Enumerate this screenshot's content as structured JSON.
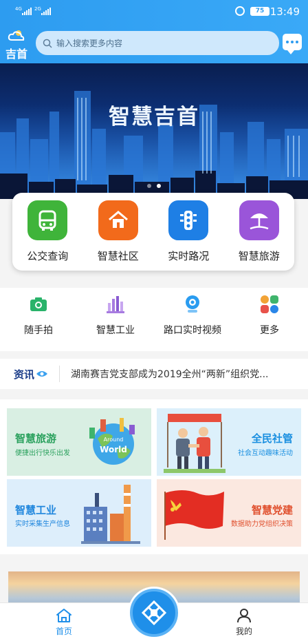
{
  "status_bar": {
    "signal1_label": "4G",
    "signal2_label": "2G",
    "battery": "75",
    "time": "13:49"
  },
  "header": {
    "city": "吉首",
    "search_placeholder": "输入搜索更多内容"
  },
  "banner": {
    "title": "智慧吉首",
    "active_slide": 2,
    "slide_count": 2
  },
  "quick_menu": [
    {
      "label": "公交查询",
      "icon": "bus-icon",
      "color": "#3fb43a"
    },
    {
      "label": "智慧社区",
      "icon": "home-icon",
      "color": "#f26a1b"
    },
    {
      "label": "实时路况",
      "icon": "traffic-light-icon",
      "color": "#1e7fe5"
    },
    {
      "label": "智慧旅游",
      "icon": "beach-umbrella-icon",
      "color": "#9a55d9"
    }
  ],
  "secondary_menu": [
    {
      "label": "随手拍",
      "icon": "camera-icon",
      "color": "#29b36a"
    },
    {
      "label": "智慧工业",
      "icon": "factory-icon",
      "color": "#a77be0"
    },
    {
      "label": "路口实时视频",
      "icon": "webcam-icon",
      "color": "#2a9cf0"
    },
    {
      "label": "更多",
      "icon": "grid-more-icon"
    }
  ],
  "news": {
    "tag": "资讯",
    "headline": "湖南赛吉党支部成为2019全州“两新”组织党..."
  },
  "tiles": [
    {
      "title": "智慧旅游",
      "subtitle": "便捷出行快乐出发",
      "title_color": "#2aa15d",
      "bg": "#d9efe3",
      "illustration": "around-the-world-globe"
    },
    {
      "title": "全民社管",
      "subtitle": "社会互动趣味活动",
      "title_color": "#1a8fe0",
      "bg": "#dcf0fb",
      "illustration": "community-handshake"
    },
    {
      "title": "智慧工业",
      "subtitle": "实时采集生产信息",
      "title_color": "#1f86dd",
      "bg": "#ddeefb",
      "illustration": "factory-buildings"
    },
    {
      "title": "智慧党建",
      "subtitle": "数据助力党组织决策",
      "title_color": "#e0502e",
      "bg": "#fbe8e0",
      "illustration": "party-flag"
    }
  ],
  "tabbar": {
    "home": "首页",
    "mine": "我的",
    "accent": "#1f8fe9"
  },
  "colors": {
    "header_blue": "#2d9cf0"
  }
}
